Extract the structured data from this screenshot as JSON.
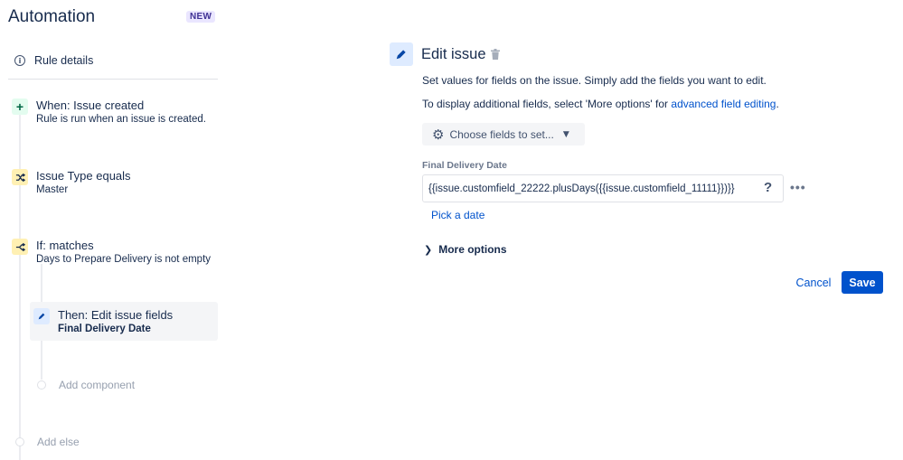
{
  "app": {
    "title": "Automation",
    "badge": "NEW"
  },
  "sidebar": {
    "rule_details": "Rule details",
    "components": [
      {
        "title": "When: Issue created",
        "subtitle": "Rule is run when an issue is created.",
        "icon": "plus-icon"
      },
      {
        "title": "Issue Type equals",
        "subtitle": "Master",
        "icon": "shuffle-icon"
      },
      {
        "title": "If: matches",
        "subtitle": "Days to Prepare Delivery is not empty",
        "icon": "branch-icon"
      },
      {
        "title": "Then: Edit issue fields",
        "subtitle": "Final Delivery Date",
        "icon": "pencil-icon"
      }
    ],
    "add_component": "Add component",
    "add_else": "Add else"
  },
  "panel": {
    "title": "Edit issue",
    "description": "Set values for fields on the issue. Simply add the fields you want to edit.",
    "additional_prefix": "To display additional fields, select 'More options' for ",
    "additional_link": "advanced field editing",
    "additional_suffix": ".",
    "choose_fields": "Choose fields to set...",
    "field_label": "Final Delivery Date",
    "field_value": "{{issue.customfield_22222.plusDays({{issue.customfield_11111}})}}",
    "help": "?",
    "more_actions": "•••",
    "pick_date": "Pick a date",
    "more_options": "More options",
    "cancel": "Cancel",
    "save": "Save"
  }
}
